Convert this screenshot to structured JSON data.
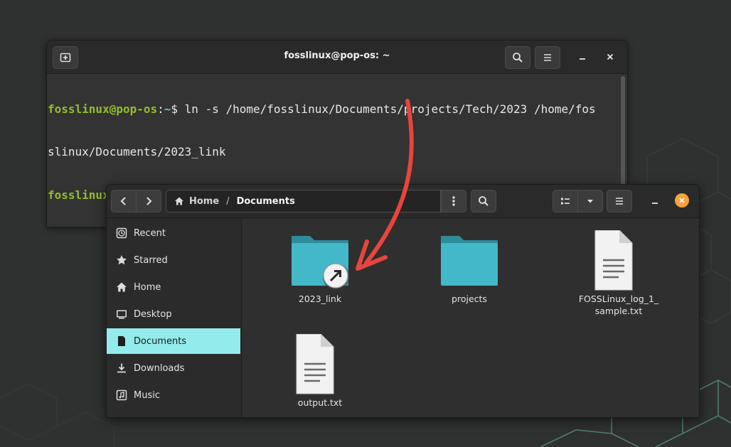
{
  "terminal": {
    "title": "fosslinux@pop-os: ~",
    "lines": [
      {
        "user": "fosslinux@pop-os",
        "colon": ":",
        "dir": "~",
        "dollar": "$ ",
        "cmd": "ln -s /home/fosslinux/Documents/projects/Tech/2023 /home/fos"
      },
      {
        "cont": "slinux/Documents/2023_link"
      },
      {
        "user": "fosslinux@pop-os",
        "colon": ":",
        "dir": "~",
        "dollar": "$ ",
        "cmd": ""
      }
    ],
    "icons": {
      "new_tab": "new-tab-icon",
      "search": "search-icon",
      "menu": "hamburger-menu-icon",
      "minimize": "minimize-icon",
      "close": "close-icon"
    }
  },
  "files": {
    "breadcrumb": [
      "Home",
      "Documents"
    ],
    "sidebar": [
      {
        "label": "Recent",
        "icon": "clock-icon"
      },
      {
        "label": "Starred",
        "icon": "star-icon"
      },
      {
        "label": "Home",
        "icon": "home-icon"
      },
      {
        "label": "Desktop",
        "icon": "desktop-icon"
      },
      {
        "label": "Documents",
        "icon": "document-icon",
        "active": true
      },
      {
        "label": "Downloads",
        "icon": "download-icon"
      },
      {
        "label": "Music",
        "icon": "music-icon"
      }
    ],
    "items": [
      {
        "name": "2023_link",
        "type": "folder-link"
      },
      {
        "name": "projects",
        "type": "folder"
      },
      {
        "name": "FOSSLinux_log_1_\nsample.txt",
        "type": "text-file"
      },
      {
        "name": "output.txt",
        "type": "text-file"
      }
    ],
    "colors": {
      "accent": "#94ebeb",
      "folder": "#42b8c8",
      "close": "#f6a33b",
      "arrow": "#e8453c"
    }
  }
}
